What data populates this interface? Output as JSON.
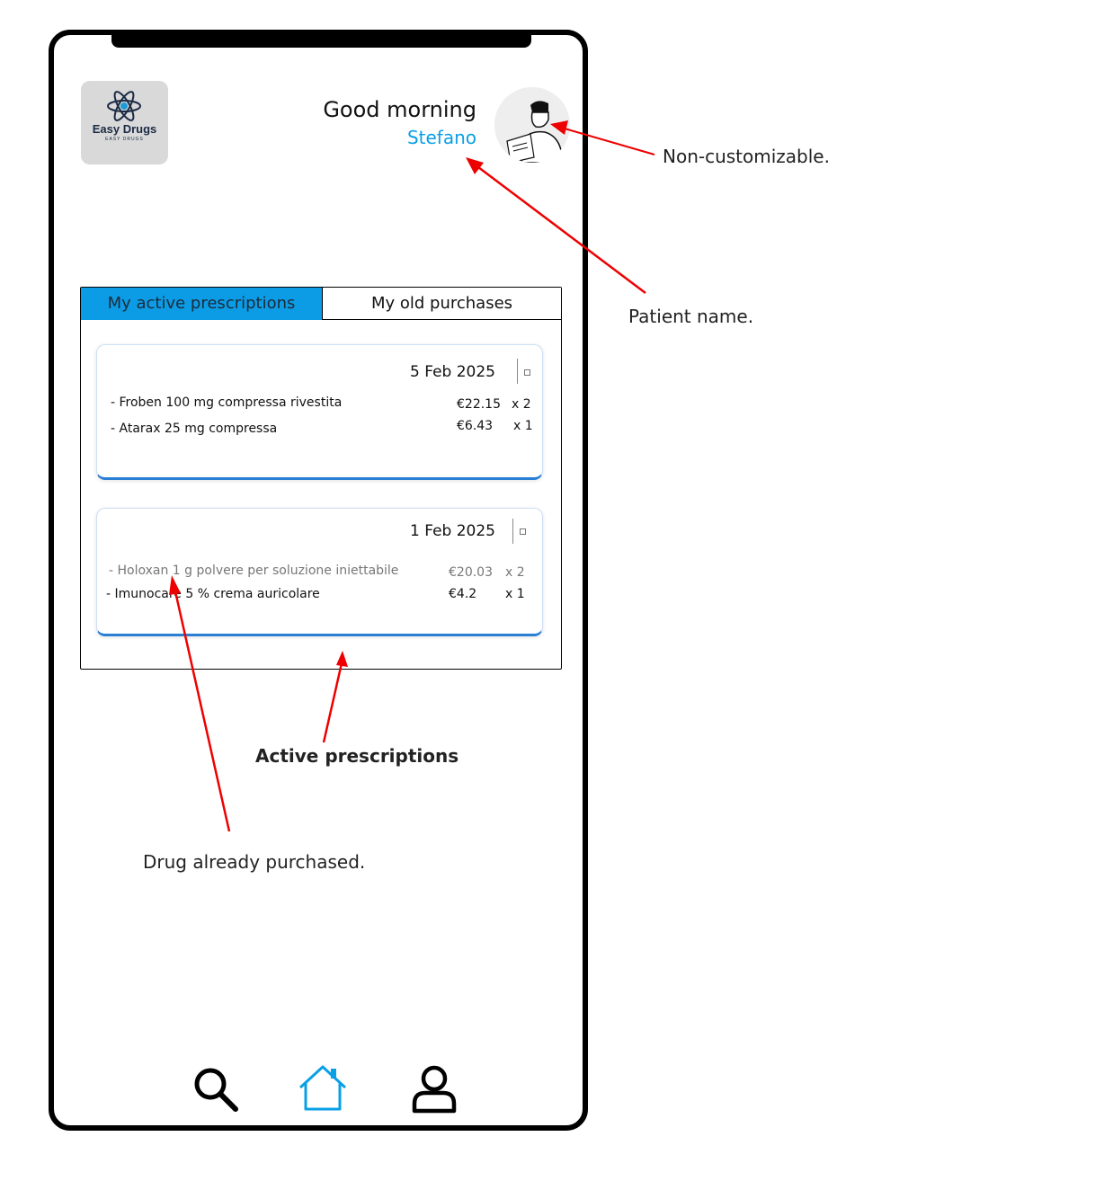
{
  "header": {
    "logo_text": "Easy Drugs",
    "logo_sub": "EASY DRUGS",
    "greeting": "Good morning",
    "username": "Stefano",
    "avatar_icon": "user-avatar-illustration"
  },
  "tabs": [
    {
      "label": "My active prescriptions",
      "active": true
    },
    {
      "label": "My old purchases",
      "active": false
    }
  ],
  "prescriptions": [
    {
      "date": "5 Feb 2025",
      "items": [
        {
          "name": "- Froben 100 mg compressa rivestita",
          "price": "€22.15",
          "qty": "x 2",
          "purchased": false
        },
        {
          "name": "- Atarax 25 mg compressa",
          "price": "€6.43",
          "qty": "x 1",
          "purchased": false
        }
      ]
    },
    {
      "date": "1 Feb 2025",
      "items": [
        {
          "name": "- Holoxan 1 g polvere per soluzione iniettabile",
          "price": "€20.03",
          "qty": "x 2",
          "purchased": true
        },
        {
          "name": "- Imunocare 5 % crema auricolare",
          "price": "€4.2",
          "qty": "x 1",
          "purchased": false
        }
      ]
    }
  ],
  "bottom_nav": [
    {
      "icon": "search-icon",
      "active": false
    },
    {
      "icon": "home-icon",
      "active": true
    },
    {
      "icon": "user-icon",
      "active": false
    }
  ],
  "annotations": {
    "avatar_note": "Non-customizable.",
    "name_note": "Patient name.",
    "active_note": "Active prescriptions",
    "purchased_note": "Drug already purchased."
  },
  "colors": {
    "accent": "#0c9ce6",
    "username": "#0aa0e6",
    "card_border": "#2a7fd4",
    "annotation_arrow": "#ee0000"
  }
}
